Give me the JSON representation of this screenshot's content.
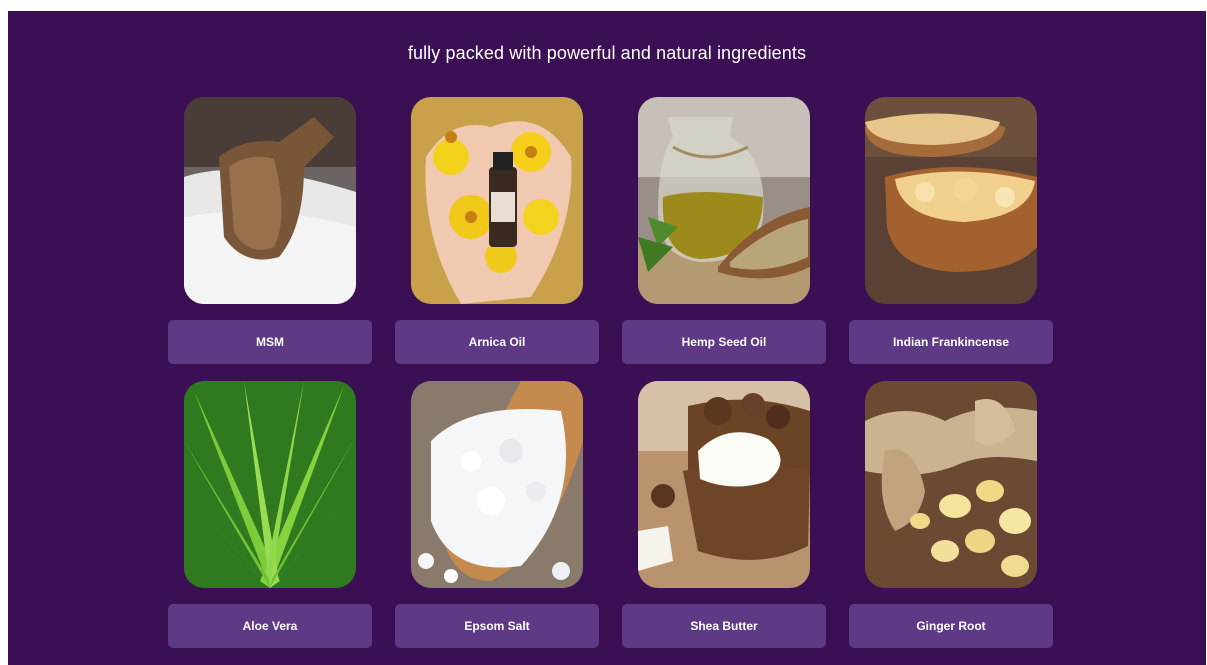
{
  "headline": "fully packed with powerful and natural ingredients",
  "colors": {
    "panel_background": "#3a0f53",
    "label_background": "#5e3985",
    "text": "#ffffff"
  },
  "ingredients": [
    {
      "label": "MSM",
      "image": "msm-photo"
    },
    {
      "label": "Arnica Oil",
      "image": "arnica-oil-photo"
    },
    {
      "label": "Hemp Seed Oil",
      "image": "hemp-seed-oil-photo"
    },
    {
      "label": "Indian Frankincense",
      "image": "indian-frankincense-photo"
    },
    {
      "label": "Aloe Vera",
      "image": "aloe-vera-photo"
    },
    {
      "label": "Epsom Salt",
      "image": "epsom-salt-photo"
    },
    {
      "label": "Shea Butter",
      "image": "shea-butter-photo"
    },
    {
      "label": "Ginger Root",
      "image": "ginger-root-photo"
    }
  ]
}
